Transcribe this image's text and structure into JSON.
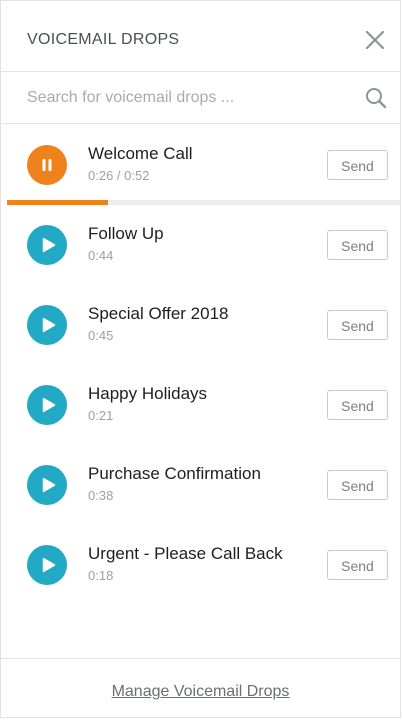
{
  "header": {
    "title": "VOICEMAIL DROPS",
    "close_icon": "close-icon"
  },
  "search": {
    "placeholder": "Search for voicemail drops ...",
    "value": "",
    "icon": "search-icon"
  },
  "colors": {
    "playing": "#f0821e",
    "idle": "#21a9c6",
    "progress_track": "#eeeeee"
  },
  "items": [
    {
      "title": "Welcome Call",
      "duration": "0:26 / 0:52",
      "state": "playing",
      "icon": "pause-icon",
      "progress": 0.5,
      "send_label": "Send"
    },
    {
      "title": "Follow Up",
      "duration": "0:44",
      "state": "idle",
      "icon": "play-icon",
      "send_label": "Send"
    },
    {
      "title": "Special Offer 2018",
      "duration": "0:45",
      "state": "idle",
      "icon": "play-icon",
      "send_label": "Send"
    },
    {
      "title": "Happy Holidays",
      "duration": "0:21",
      "state": "idle",
      "icon": "play-icon",
      "send_label": "Send"
    },
    {
      "title": "Purchase Confirmation",
      "duration": "0:38",
      "state": "idle",
      "icon": "play-icon",
      "send_label": "Send"
    },
    {
      "title": "Urgent - Please Call Back",
      "duration": "0:18",
      "state": "idle",
      "icon": "play-icon",
      "send_label": "Send"
    }
  ],
  "footer": {
    "manage_label": "Manage Voicemail Drops"
  }
}
